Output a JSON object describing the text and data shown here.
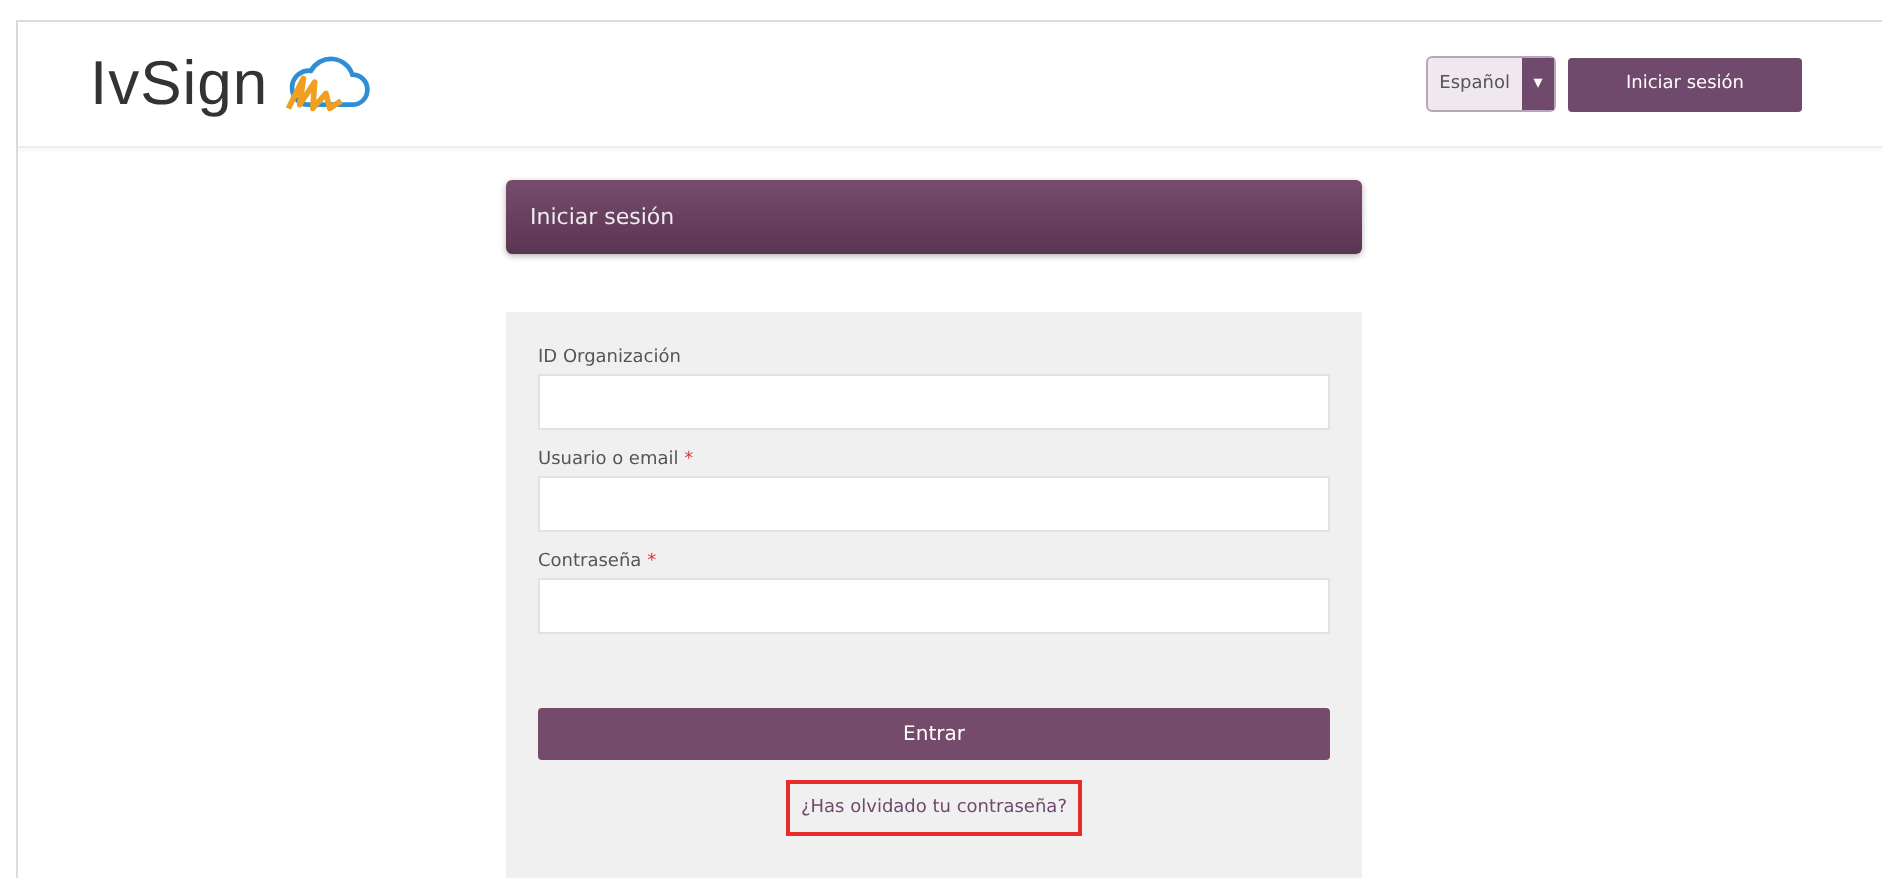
{
  "header": {
    "logo": "IvSign",
    "language": {
      "value": "Español",
      "caret": "▾"
    },
    "login_button": "Iniciar sesión"
  },
  "panel_title": "Iniciar sesión",
  "fields": [
    {
      "label": "ID Organización",
      "required": false
    },
    {
      "label": "Usuario o email",
      "required": true
    },
    {
      "label": "Contraseña",
      "required": true
    }
  ],
  "required_mark": "*",
  "submit": "Entrar",
  "forgot_link": {
    "label": "¿Has olvidado tu contraseña?",
    "highlighted": true
  }
}
